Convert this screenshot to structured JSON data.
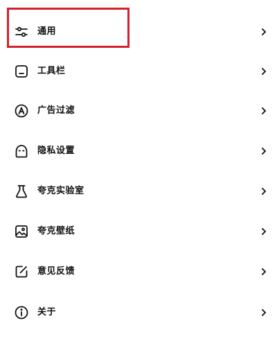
{
  "settings": {
    "items": [
      {
        "label": "通用",
        "icon": "sliders-icon"
      },
      {
        "label": "工具栏",
        "icon": "toolbar-icon"
      },
      {
        "label": "广告过滤",
        "icon": "ad-filter-icon"
      },
      {
        "label": "隐私设置",
        "icon": "privacy-icon"
      },
      {
        "label": "夸克实验室",
        "icon": "flask-icon"
      },
      {
        "label": "夸克壁纸",
        "icon": "wallpaper-icon"
      },
      {
        "label": "意见反馈",
        "icon": "feedback-icon"
      },
      {
        "label": "关于",
        "icon": "info-icon"
      }
    ],
    "chevron_icon": "chevron-right-icon"
  },
  "annotation": {
    "highlight_color": "#d4202b",
    "highlighted_item": "通用"
  }
}
